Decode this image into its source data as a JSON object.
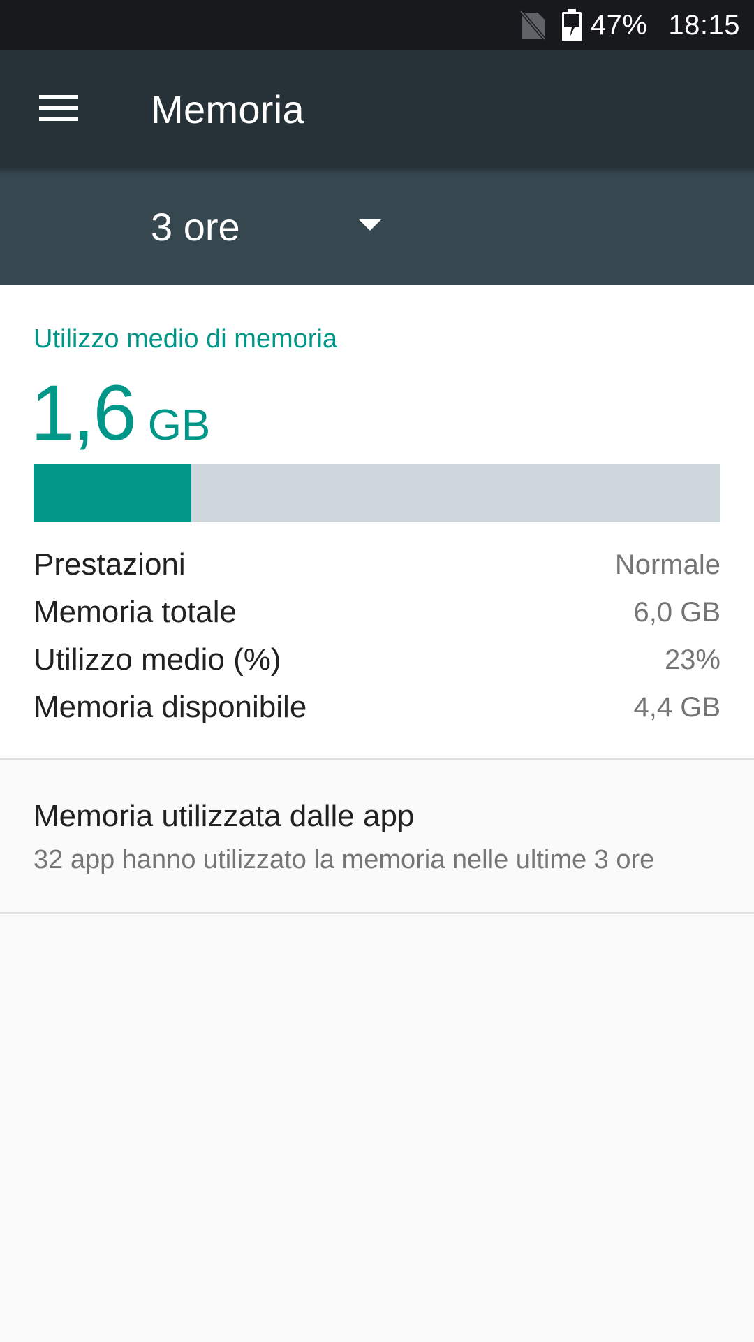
{
  "status_bar": {
    "battery": "47%",
    "time": "18:15",
    "icons": [
      "no-sim-icon",
      "battery-charging-icon"
    ]
  },
  "toolbar": {
    "title": "Memoria",
    "menu_icon": "hamburger-menu-icon"
  },
  "period": {
    "selected": "3 ore",
    "arrow_icon": "dropdown-arrow-icon"
  },
  "summary": {
    "label": "Utilizzo medio di memoria",
    "value": "1,6",
    "unit": "GB",
    "usage_fraction": 0.23
  },
  "stats": [
    {
      "label": "Prestazioni",
      "value": "Normale"
    },
    {
      "label": "Memoria totale",
      "value": "6,0 GB"
    },
    {
      "label": "Utilizzo medio (%)",
      "value": "23%"
    },
    {
      "label": "Memoria disponibile",
      "value": "4,4 GB"
    }
  ],
  "app_memory": {
    "title": "Memoria utilizzata dalle app",
    "subtitle": "32 app hanno utilizzato la memoria nelle ultime 3 ore"
  },
  "colors": {
    "accent": "#009688",
    "toolbar": "#263238",
    "spinner_bar": "#37474f",
    "status_bar": "#17191c",
    "bar_track": "#cfd8dc"
  }
}
